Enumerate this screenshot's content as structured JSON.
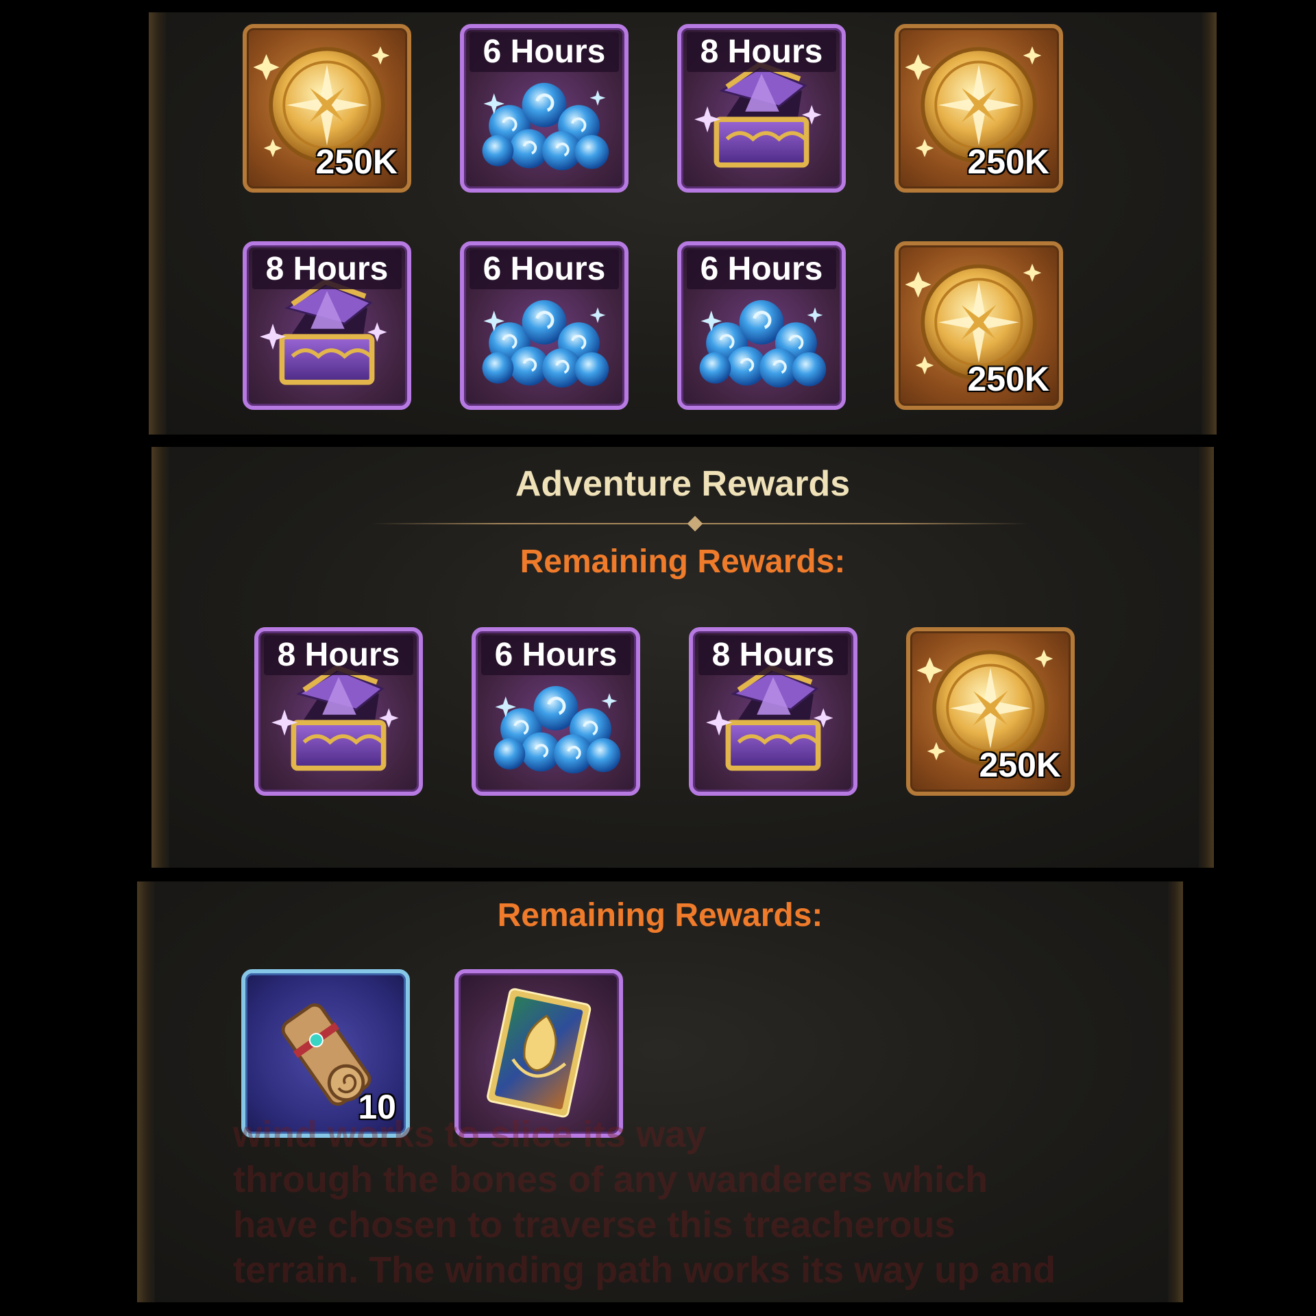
{
  "colors": {
    "title": "#efe1b8",
    "subtitle": "#ef7b2b",
    "gold_frame": "#b57a38",
    "purple_frame": "#b77ae2",
    "blue_frame": "#86c7e8"
  },
  "panel1": {
    "rows": [
      [
        {
          "kind": "gold-coin",
          "icon": "gold-coin-icon",
          "quantity": "250K"
        },
        {
          "kind": "spirit-orbs",
          "icon": "blue-orbs-icon",
          "duration": "6 Hours"
        },
        {
          "kind": "hero-chest",
          "icon": "purple-chest-icon",
          "duration": "8 Hours"
        },
        {
          "kind": "gold-coin",
          "icon": "gold-coin-icon",
          "quantity": "250K"
        }
      ],
      [
        {
          "kind": "hero-chest",
          "icon": "purple-chest-icon",
          "duration": "8 Hours"
        },
        {
          "kind": "spirit-orbs",
          "icon": "blue-orbs-icon",
          "duration": "6 Hours"
        },
        {
          "kind": "spirit-orbs",
          "icon": "blue-orbs-icon",
          "duration": "6 Hours"
        },
        {
          "kind": "gold-coin",
          "icon": "gold-coin-icon",
          "quantity": "250K"
        }
      ]
    ]
  },
  "panel2": {
    "title": "Adventure Rewards",
    "subtitle": "Remaining Rewards:",
    "items": [
      {
        "kind": "hero-chest",
        "icon": "purple-chest-icon",
        "duration": "8 Hours"
      },
      {
        "kind": "spirit-orbs",
        "icon": "blue-orbs-icon",
        "duration": "6 Hours"
      },
      {
        "kind": "hero-chest",
        "icon": "purple-chest-icon",
        "duration": "8 Hours"
      },
      {
        "kind": "gold-coin",
        "icon": "gold-coin-icon",
        "quantity": "250K"
      }
    ]
  },
  "panel3": {
    "subtitle": "Remaining Rewards:",
    "items": [
      {
        "kind": "scroll",
        "icon": "scroll-icon",
        "quantity": "10"
      },
      {
        "kind": "hero-card",
        "icon": "hero-card-icon"
      }
    ],
    "background_text": "wind works to slice its way\nthrough the bones of any wanderers which\nhave chosen to traverse this treacherous\nterrain. The winding path works its way up and"
  }
}
